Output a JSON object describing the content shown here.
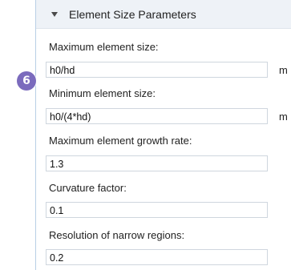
{
  "section": {
    "title": "Element Size Parameters"
  },
  "step_badge": "6",
  "fields": [
    {
      "label": "Maximum element size:",
      "value": "h0/hd",
      "unit": "m"
    },
    {
      "label": "Minimum element size:",
      "value": "h0/(4*hd)",
      "unit": "m"
    },
    {
      "label": "Maximum element growth rate:",
      "value": "1.3"
    },
    {
      "label": "Curvature factor:",
      "value": "0.1"
    },
    {
      "label": "Resolution of narrow regions:",
      "value": "0.2"
    }
  ]
}
